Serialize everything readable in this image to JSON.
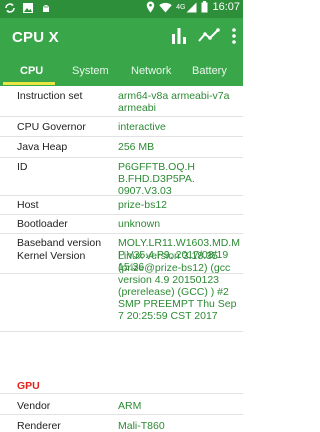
{
  "status_bar": {
    "time": "16:07",
    "network_label": "4G",
    "left_icons": [
      "sync-icon",
      "gallery-icon",
      "android-debug-icon"
    ],
    "right_icons": [
      "location-icon",
      "wifi-icon",
      "signal-icon",
      "battery-icon"
    ]
  },
  "app": {
    "title": "CPU X",
    "bg_color": "#3aa64a",
    "status_color": "#2e8f3a",
    "accent": "#e9e542",
    "actions": [
      "bar-chart-icon",
      "trend-chart-icon",
      "more-vert-icon"
    ]
  },
  "tabs": [
    {
      "label": "CPU",
      "active": true
    },
    {
      "label": "System",
      "active": false
    },
    {
      "label": "Network",
      "active": false
    },
    {
      "label": "Battery",
      "active": false
    }
  ],
  "cpu_rows": [
    {
      "label": "Instruction set",
      "value": "arm64-v8a armeabi-v7a armeabi"
    },
    {
      "label": "CPU Governor",
      "value": "interactive"
    },
    {
      "label": "Java Heap",
      "value": "256 MB"
    },
    {
      "label": "ID",
      "value": "P6GFFTB.OQ.H\nB.FHD.D3P5PA.\n0907.V3.03"
    },
    {
      "label": "Host",
      "value": "prize-bs12"
    },
    {
      "label": "Bootloader",
      "value": "unknown"
    },
    {
      "label": "Baseband version",
      "value": "MOLY.LR11.W1603.MD.M\nP.V35.4.P9, 2017/08/19\n15:36"
    },
    {
      "label": "Kernel Version",
      "value": "Linux version 3.18.35 (prize@prize-bs12) (gcc version 4.9 20150123 (prerelease) (GCC) ) #2 SMP PREEMPT Thu Sep 7 20:25:59 CST 2017"
    }
  ],
  "gpu_section": {
    "title": "GPU",
    "rows": [
      {
        "label": "Vendor",
        "value": "ARM"
      },
      {
        "label": "Renderer",
        "value": "Mali-T860"
      }
    ]
  }
}
